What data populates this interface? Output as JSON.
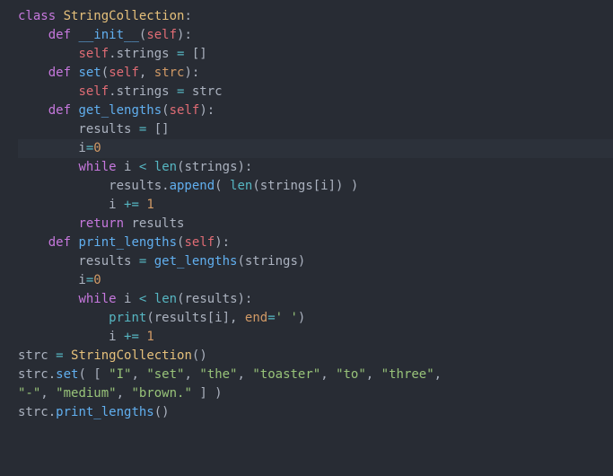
{
  "code": {
    "lines": [
      {
        "hl": false,
        "tokens": [
          {
            "c": "kw",
            "t": "class"
          },
          {
            "c": "punct",
            "t": " "
          },
          {
            "c": "cls",
            "t": "StringCollection"
          },
          {
            "c": "punct",
            "t": ":"
          }
        ]
      },
      {
        "hl": false,
        "tokens": [
          {
            "c": "punct",
            "t": "    "
          },
          {
            "c": "kw",
            "t": "def"
          },
          {
            "c": "punct",
            "t": " "
          },
          {
            "c": "fn",
            "t": "__init__"
          },
          {
            "c": "punct",
            "t": "("
          },
          {
            "c": "self",
            "t": "self"
          },
          {
            "c": "punct",
            "t": "):"
          }
        ]
      },
      {
        "hl": false,
        "tokens": [
          {
            "c": "punct",
            "t": "        "
          },
          {
            "c": "self",
            "t": "self"
          },
          {
            "c": "punct",
            "t": ".strings "
          },
          {
            "c": "op",
            "t": "="
          },
          {
            "c": "punct",
            "t": " []"
          }
        ]
      },
      {
        "hl": false,
        "tokens": [
          {
            "c": "punct",
            "t": "    "
          },
          {
            "c": "kw",
            "t": "def"
          },
          {
            "c": "punct",
            "t": " "
          },
          {
            "c": "fn",
            "t": "set"
          },
          {
            "c": "punct",
            "t": "("
          },
          {
            "c": "self",
            "t": "self"
          },
          {
            "c": "punct",
            "t": ", "
          },
          {
            "c": "param",
            "t": "strc"
          },
          {
            "c": "punct",
            "t": "):"
          }
        ]
      },
      {
        "hl": false,
        "tokens": [
          {
            "c": "punct",
            "t": "        "
          },
          {
            "c": "self",
            "t": "self"
          },
          {
            "c": "punct",
            "t": ".strings "
          },
          {
            "c": "op",
            "t": "="
          },
          {
            "c": "punct",
            "t": " strc"
          }
        ]
      },
      {
        "hl": false,
        "tokens": [
          {
            "c": "punct",
            "t": "    "
          },
          {
            "c": "kw",
            "t": "def"
          },
          {
            "c": "punct",
            "t": " "
          },
          {
            "c": "fn",
            "t": "get_lengths"
          },
          {
            "c": "punct",
            "t": "("
          },
          {
            "c": "self",
            "t": "self"
          },
          {
            "c": "punct",
            "t": "):"
          }
        ]
      },
      {
        "hl": false,
        "tokens": [
          {
            "c": "punct",
            "t": "        results "
          },
          {
            "c": "op",
            "t": "="
          },
          {
            "c": "punct",
            "t": " []"
          }
        ]
      },
      {
        "hl": true,
        "tokens": [
          {
            "c": "punct",
            "t": "        i"
          },
          {
            "c": "op",
            "t": "="
          },
          {
            "c": "param",
            "t": "0"
          }
        ]
      },
      {
        "hl": false,
        "tokens": [
          {
            "c": "punct",
            "t": "        "
          },
          {
            "c": "kw",
            "t": "while"
          },
          {
            "c": "punct",
            "t": " i "
          },
          {
            "c": "op",
            "t": "<"
          },
          {
            "c": "punct",
            "t": " "
          },
          {
            "c": "builtin",
            "t": "len"
          },
          {
            "c": "punct",
            "t": "(strings):"
          }
        ]
      },
      {
        "hl": false,
        "tokens": [
          {
            "c": "punct",
            "t": "            results."
          },
          {
            "c": "fn",
            "t": "append"
          },
          {
            "c": "punct",
            "t": "( "
          },
          {
            "c": "builtin",
            "t": "len"
          },
          {
            "c": "punct",
            "t": "(strings[i]) )"
          }
        ]
      },
      {
        "hl": false,
        "tokens": [
          {
            "c": "punct",
            "t": "            i "
          },
          {
            "c": "op",
            "t": "+="
          },
          {
            "c": "punct",
            "t": " "
          },
          {
            "c": "param",
            "t": "1"
          }
        ]
      },
      {
        "hl": false,
        "tokens": [
          {
            "c": "punct",
            "t": "        "
          },
          {
            "c": "kw",
            "t": "return"
          },
          {
            "c": "punct",
            "t": " results"
          }
        ]
      },
      {
        "hl": false,
        "tokens": [
          {
            "c": "punct",
            "t": "    "
          },
          {
            "c": "kw",
            "t": "def"
          },
          {
            "c": "punct",
            "t": " "
          },
          {
            "c": "fn",
            "t": "print_lengths"
          },
          {
            "c": "punct",
            "t": "("
          },
          {
            "c": "self",
            "t": "self"
          },
          {
            "c": "punct",
            "t": "):"
          }
        ]
      },
      {
        "hl": false,
        "tokens": [
          {
            "c": "punct",
            "t": "        results "
          },
          {
            "c": "op",
            "t": "="
          },
          {
            "c": "punct",
            "t": " "
          },
          {
            "c": "fn",
            "t": "get_lengths"
          },
          {
            "c": "punct",
            "t": "(strings)"
          }
        ]
      },
      {
        "hl": false,
        "tokens": [
          {
            "c": "punct",
            "t": "        i"
          },
          {
            "c": "op",
            "t": "="
          },
          {
            "c": "param",
            "t": "0"
          }
        ]
      },
      {
        "hl": false,
        "tokens": [
          {
            "c": "punct",
            "t": "        "
          },
          {
            "c": "kw",
            "t": "while"
          },
          {
            "c": "punct",
            "t": " i "
          },
          {
            "c": "op",
            "t": "<"
          },
          {
            "c": "punct",
            "t": " "
          },
          {
            "c": "builtin",
            "t": "len"
          },
          {
            "c": "punct",
            "t": "(results):"
          }
        ]
      },
      {
        "hl": false,
        "tokens": [
          {
            "c": "punct",
            "t": "            "
          },
          {
            "c": "builtin",
            "t": "print"
          },
          {
            "c": "punct",
            "t": "(results[i], "
          },
          {
            "c": "param",
            "t": "end"
          },
          {
            "c": "op",
            "t": "="
          },
          {
            "c": "str",
            "t": "' '"
          },
          {
            "c": "punct",
            "t": ")"
          }
        ]
      },
      {
        "hl": false,
        "tokens": [
          {
            "c": "punct",
            "t": "            i "
          },
          {
            "c": "op",
            "t": "+="
          },
          {
            "c": "punct",
            "t": " "
          },
          {
            "c": "param",
            "t": "1"
          }
        ]
      },
      {
        "hl": false,
        "tokens": [
          {
            "c": "punct",
            "t": "strc "
          },
          {
            "c": "op",
            "t": "="
          },
          {
            "c": "punct",
            "t": " "
          },
          {
            "c": "cls",
            "t": "StringCollection"
          },
          {
            "c": "punct",
            "t": "()"
          }
        ]
      },
      {
        "hl": false,
        "tokens": [
          {
            "c": "punct",
            "t": "strc."
          },
          {
            "c": "fn",
            "t": "set"
          },
          {
            "c": "punct",
            "t": "( [ "
          },
          {
            "c": "str",
            "t": "\"I\""
          },
          {
            "c": "punct",
            "t": ", "
          },
          {
            "c": "str",
            "t": "\"set\""
          },
          {
            "c": "punct",
            "t": ", "
          },
          {
            "c": "str",
            "t": "\"the\""
          },
          {
            "c": "punct",
            "t": ", "
          },
          {
            "c": "str",
            "t": "\"toaster\""
          },
          {
            "c": "punct",
            "t": ", "
          },
          {
            "c": "str",
            "t": "\"to\""
          },
          {
            "c": "punct",
            "t": ", "
          },
          {
            "c": "str",
            "t": "\"three\""
          },
          {
            "c": "punct",
            "t": ","
          }
        ]
      },
      {
        "hl": false,
        "tokens": [
          {
            "c": "str",
            "t": "\"-\""
          },
          {
            "c": "punct",
            "t": ", "
          },
          {
            "c": "str",
            "t": "\"medium\""
          },
          {
            "c": "punct",
            "t": ", "
          },
          {
            "c": "str",
            "t": "\"brown.\""
          },
          {
            "c": "punct",
            "t": " ] )"
          }
        ]
      },
      {
        "hl": false,
        "tokens": [
          {
            "c": "punct",
            "t": "strc."
          },
          {
            "c": "fn",
            "t": "print_lengths"
          },
          {
            "c": "punct",
            "t": "()"
          }
        ]
      }
    ]
  }
}
